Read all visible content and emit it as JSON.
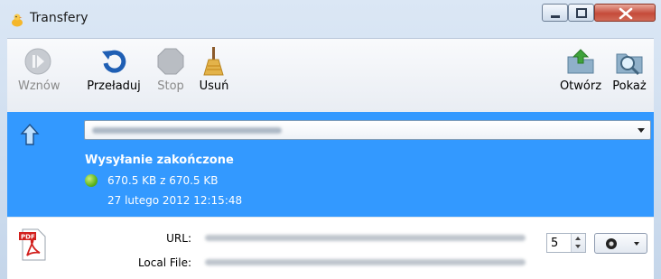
{
  "window": {
    "title": "Transfery"
  },
  "toolbar": {
    "resume_label": "Wznów",
    "reload_label": "Przeładuj",
    "stop_label": "Stop",
    "remove_label": "Usuń",
    "open_label": "Otwórz",
    "show_label": "Pokaż"
  },
  "transfer": {
    "status": "Wysyłanie zakończone",
    "size": "670.5 KB z 670.5 KB",
    "date": "27 lutego 2012 12:15:48"
  },
  "details": {
    "url_label": "URL:",
    "local_label": "Local File:",
    "spinner_value": "5"
  },
  "colors": {
    "selection": "#3399ff",
    "status_dot": "#5fb51e"
  },
  "icons": [
    "app-icon",
    "resume-icon",
    "reload-icon",
    "stop-icon",
    "broom-icon",
    "open-folder-icon",
    "search-folder-icon",
    "upload-arrow-icon",
    "pdf-file-icon"
  ]
}
